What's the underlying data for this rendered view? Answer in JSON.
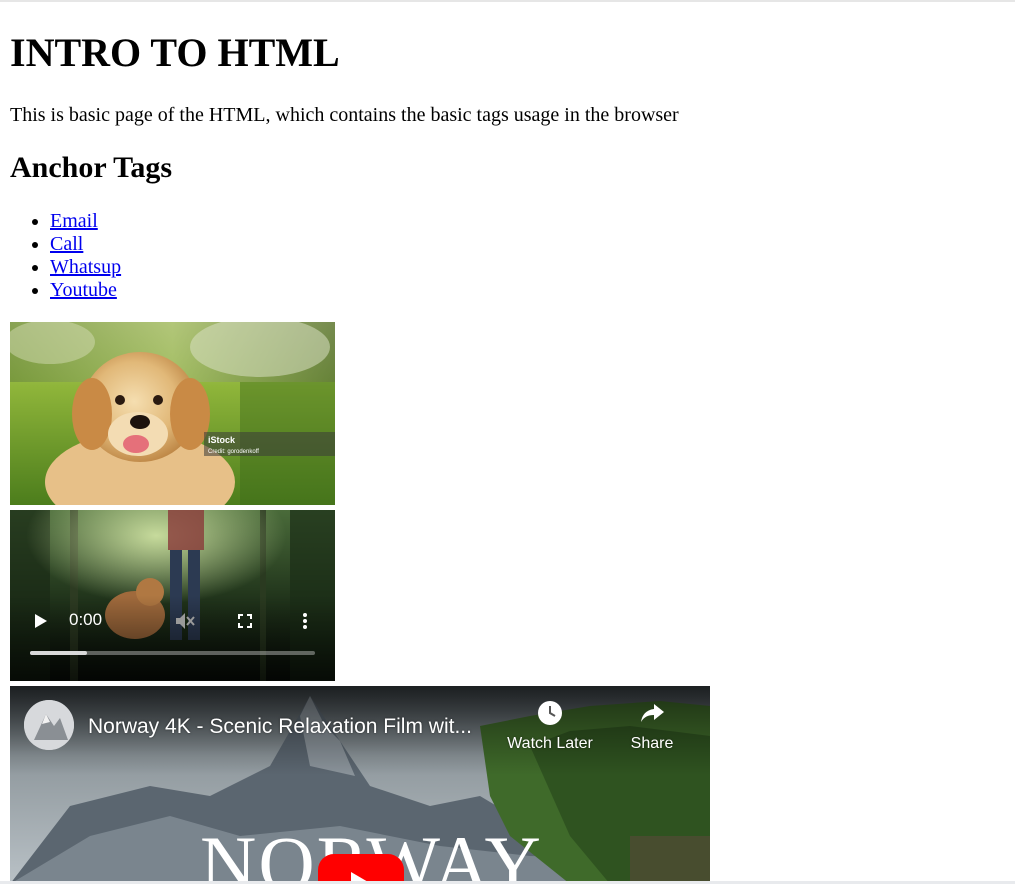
{
  "page": {
    "heading": "INTRO TO HTML",
    "intro": "This is basic page of the HTML, which contains the basic tags usage in the browser",
    "anchor_heading": "Anchor Tags"
  },
  "links": [
    {
      "label": "Email"
    },
    {
      "label": "Call"
    },
    {
      "label": "Whatsup"
    },
    {
      "label": "Youtube"
    }
  ],
  "image": {
    "watermark": "iStock",
    "credit": "Credit: gorodenkoff"
  },
  "video": {
    "time": "0:00",
    "progress": 0.2,
    "icons": [
      "play-icon",
      "mute-icon",
      "fullscreen-icon",
      "more-options-icon"
    ]
  },
  "youtube": {
    "title": "Norway 4K - Scenic Relaxation Film wit...",
    "watch_later": "Watch Later",
    "share": "Share",
    "overlay_text": "NORWAY",
    "icons": [
      "clock-icon",
      "share-icon",
      "youtube-play-icon"
    ]
  },
  "colors": {
    "link": "#0000ee",
    "youtube_red": "#ff0000"
  }
}
